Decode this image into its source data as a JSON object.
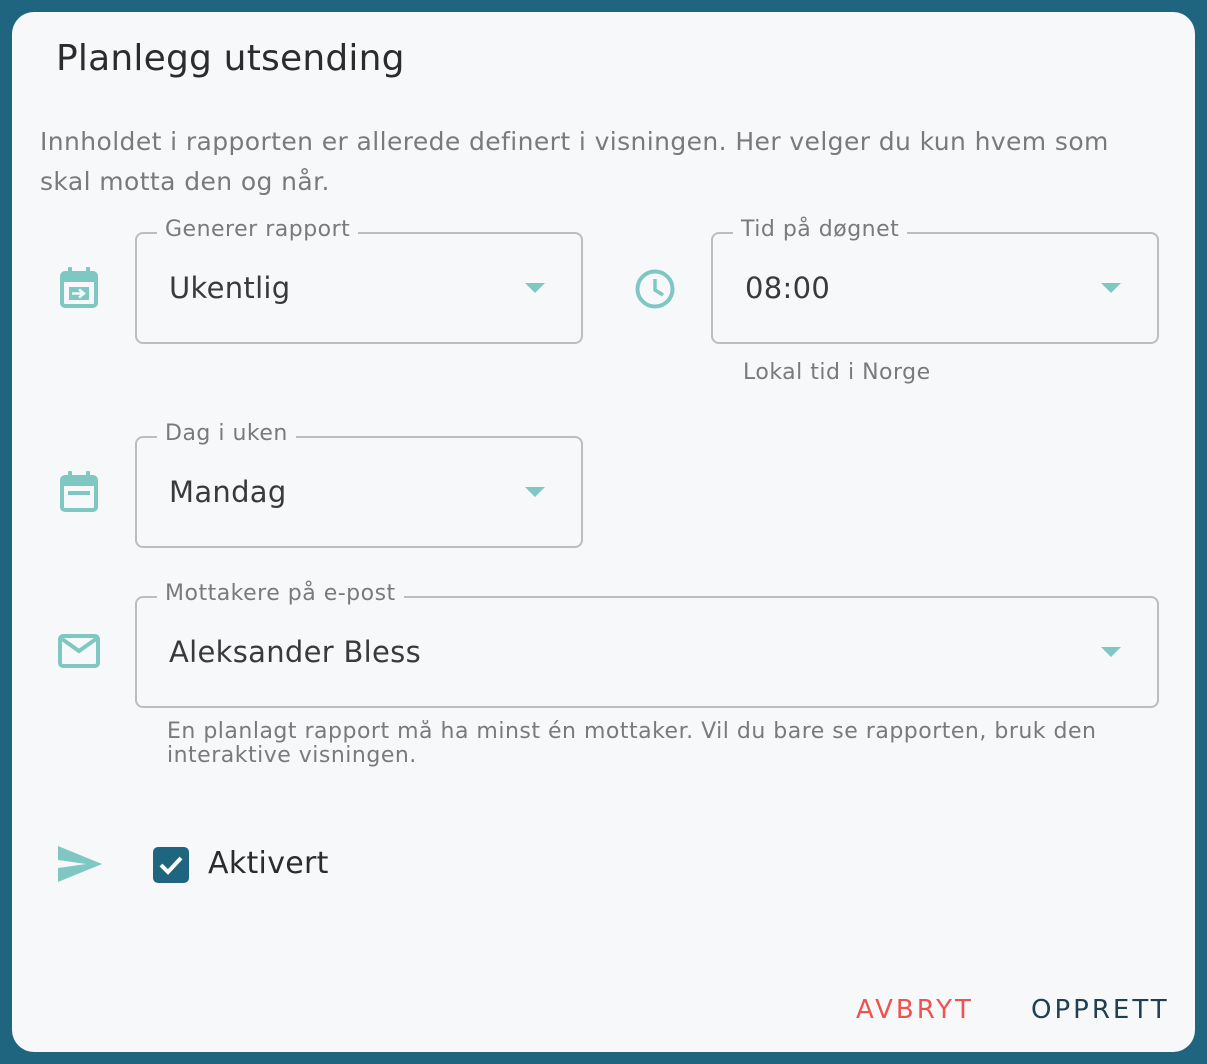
{
  "dialog": {
    "title": "Planlegg utsending",
    "description": "Innholdet i rapporten er allerede definert i visningen. Her velger du kun hvem som skal motta den og når."
  },
  "fields": {
    "frequency": {
      "label": "Generer rapport",
      "value": "Ukentlig",
      "icon": "calendar-arrow-icon"
    },
    "time": {
      "label": "Tid på døgnet",
      "value": "08:00",
      "helper": "Lokal tid i Norge",
      "icon": "clock-icon"
    },
    "weekday": {
      "label": "Dag i uken",
      "value": "Mandag",
      "icon": "calendar-icon"
    },
    "recipients": {
      "label": "Mottakere på e-post",
      "value": "Aleksander Bless",
      "helper": "En planlagt rapport må ha minst én mottaker. Vil du bare se rapporten, bruk den interaktive visningen.",
      "icon": "mail-icon"
    }
  },
  "activated": {
    "label": "Aktivert",
    "checked": true,
    "icon": "send-icon"
  },
  "actions": {
    "cancel": "AVBRYT",
    "create": "OPPRETT"
  },
  "colors": {
    "accent": "#7fc7c2",
    "primary": "#1f6580",
    "cancel": "#ef5350",
    "background": "#1f6580"
  }
}
